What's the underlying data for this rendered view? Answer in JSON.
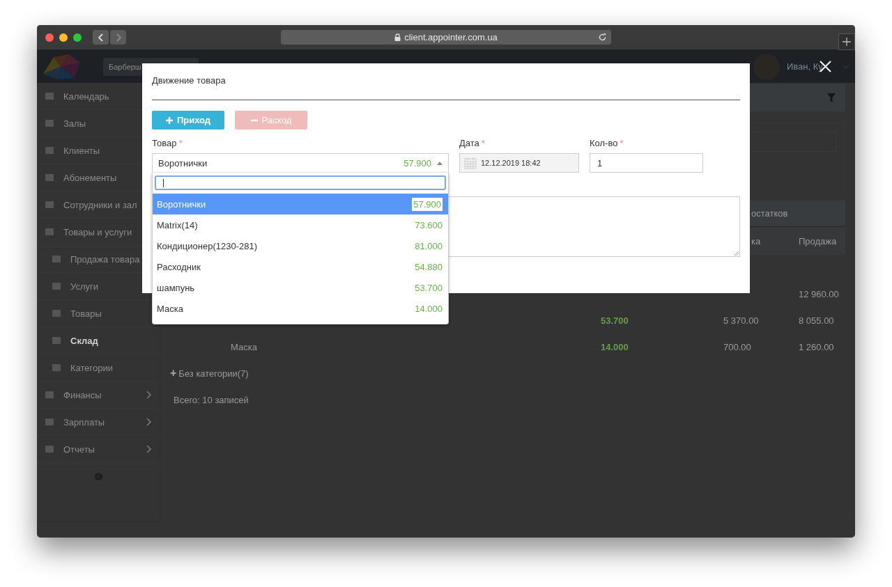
{
  "browser": {
    "url": "client.appointer.com.ua"
  },
  "header": {
    "branch": "Барберш",
    "user": "Иван, Ку"
  },
  "sidebar": [
    {
      "label": "Календарь",
      "kind": "top",
      "selected": false
    },
    {
      "label": "Залы",
      "kind": "top",
      "selected": false
    },
    {
      "label": "Клиенты",
      "kind": "top",
      "selected": false
    },
    {
      "label": "Абонементы",
      "kind": "top",
      "selected": false
    },
    {
      "label": "Сотрудники и зал",
      "kind": "top",
      "selected": false
    },
    {
      "label": "Товары и услуги",
      "kind": "top",
      "selected": false
    },
    {
      "label": "Продажа товара",
      "kind": "sub",
      "selected": false
    },
    {
      "label": "Услуги",
      "kind": "sub",
      "selected": false
    },
    {
      "label": "Товары",
      "kind": "sub",
      "selected": false
    },
    {
      "label": "Склад",
      "kind": "sub",
      "selected": true
    },
    {
      "label": "Категории",
      "kind": "sub",
      "selected": false
    },
    {
      "label": "Финансы",
      "kind": "group",
      "selected": false
    },
    {
      "label": "Зарплаты",
      "kind": "group",
      "selected": false
    },
    {
      "label": "Отчеты",
      "kind": "group",
      "selected": false
    }
  ],
  "table": {
    "band_label": "остатков",
    "columns": [
      "ка",
      "Продажа"
    ],
    "rows": [
      {
        "sale": "12 960.00"
      },
      {
        "stock": "53.700",
        "cost": "5 370.00",
        "sale": "8 055.00"
      },
      {
        "name": "Маска",
        "stock": "14.000",
        "cost": "700.00",
        "sale": "1 260.00"
      }
    ]
  },
  "category": {
    "icon": "+",
    "label": "Без категории(7)"
  },
  "total": "Всего: 10 записей",
  "modal": {
    "title": "Движение товара",
    "buttons": [
      {
        "label": "Приход",
        "kind": "plus",
        "disabled": false
      },
      {
        "label": "Расход",
        "kind": "minus",
        "disabled": true
      }
    ],
    "product": {
      "label": "Товар",
      "required_mark": "*",
      "value": "Воротнички",
      "price": "57.900",
      "expanded": true
    },
    "date": {
      "label": "Дата",
      "required_mark": "*",
      "value": "12.12.2019 18:42"
    },
    "qty": {
      "label": "Кол-во",
      "required_mark": "*",
      "value": "1"
    },
    "options": [
      {
        "name": "Воротнички",
        "price": "57.900",
        "selected": true
      },
      {
        "name": "Matrix(14)",
        "price": "73.600",
        "selected": false
      },
      {
        "name": "Кондиционер(1230-281)",
        "price": "81.000",
        "selected": false
      },
      {
        "name": "Расходник",
        "price": "54.880",
        "selected": false
      },
      {
        "name": "шампунь",
        "price": "53.700",
        "selected": false
      },
      {
        "name": "Маска",
        "price": "14.000",
        "selected": false
      }
    ]
  }
}
